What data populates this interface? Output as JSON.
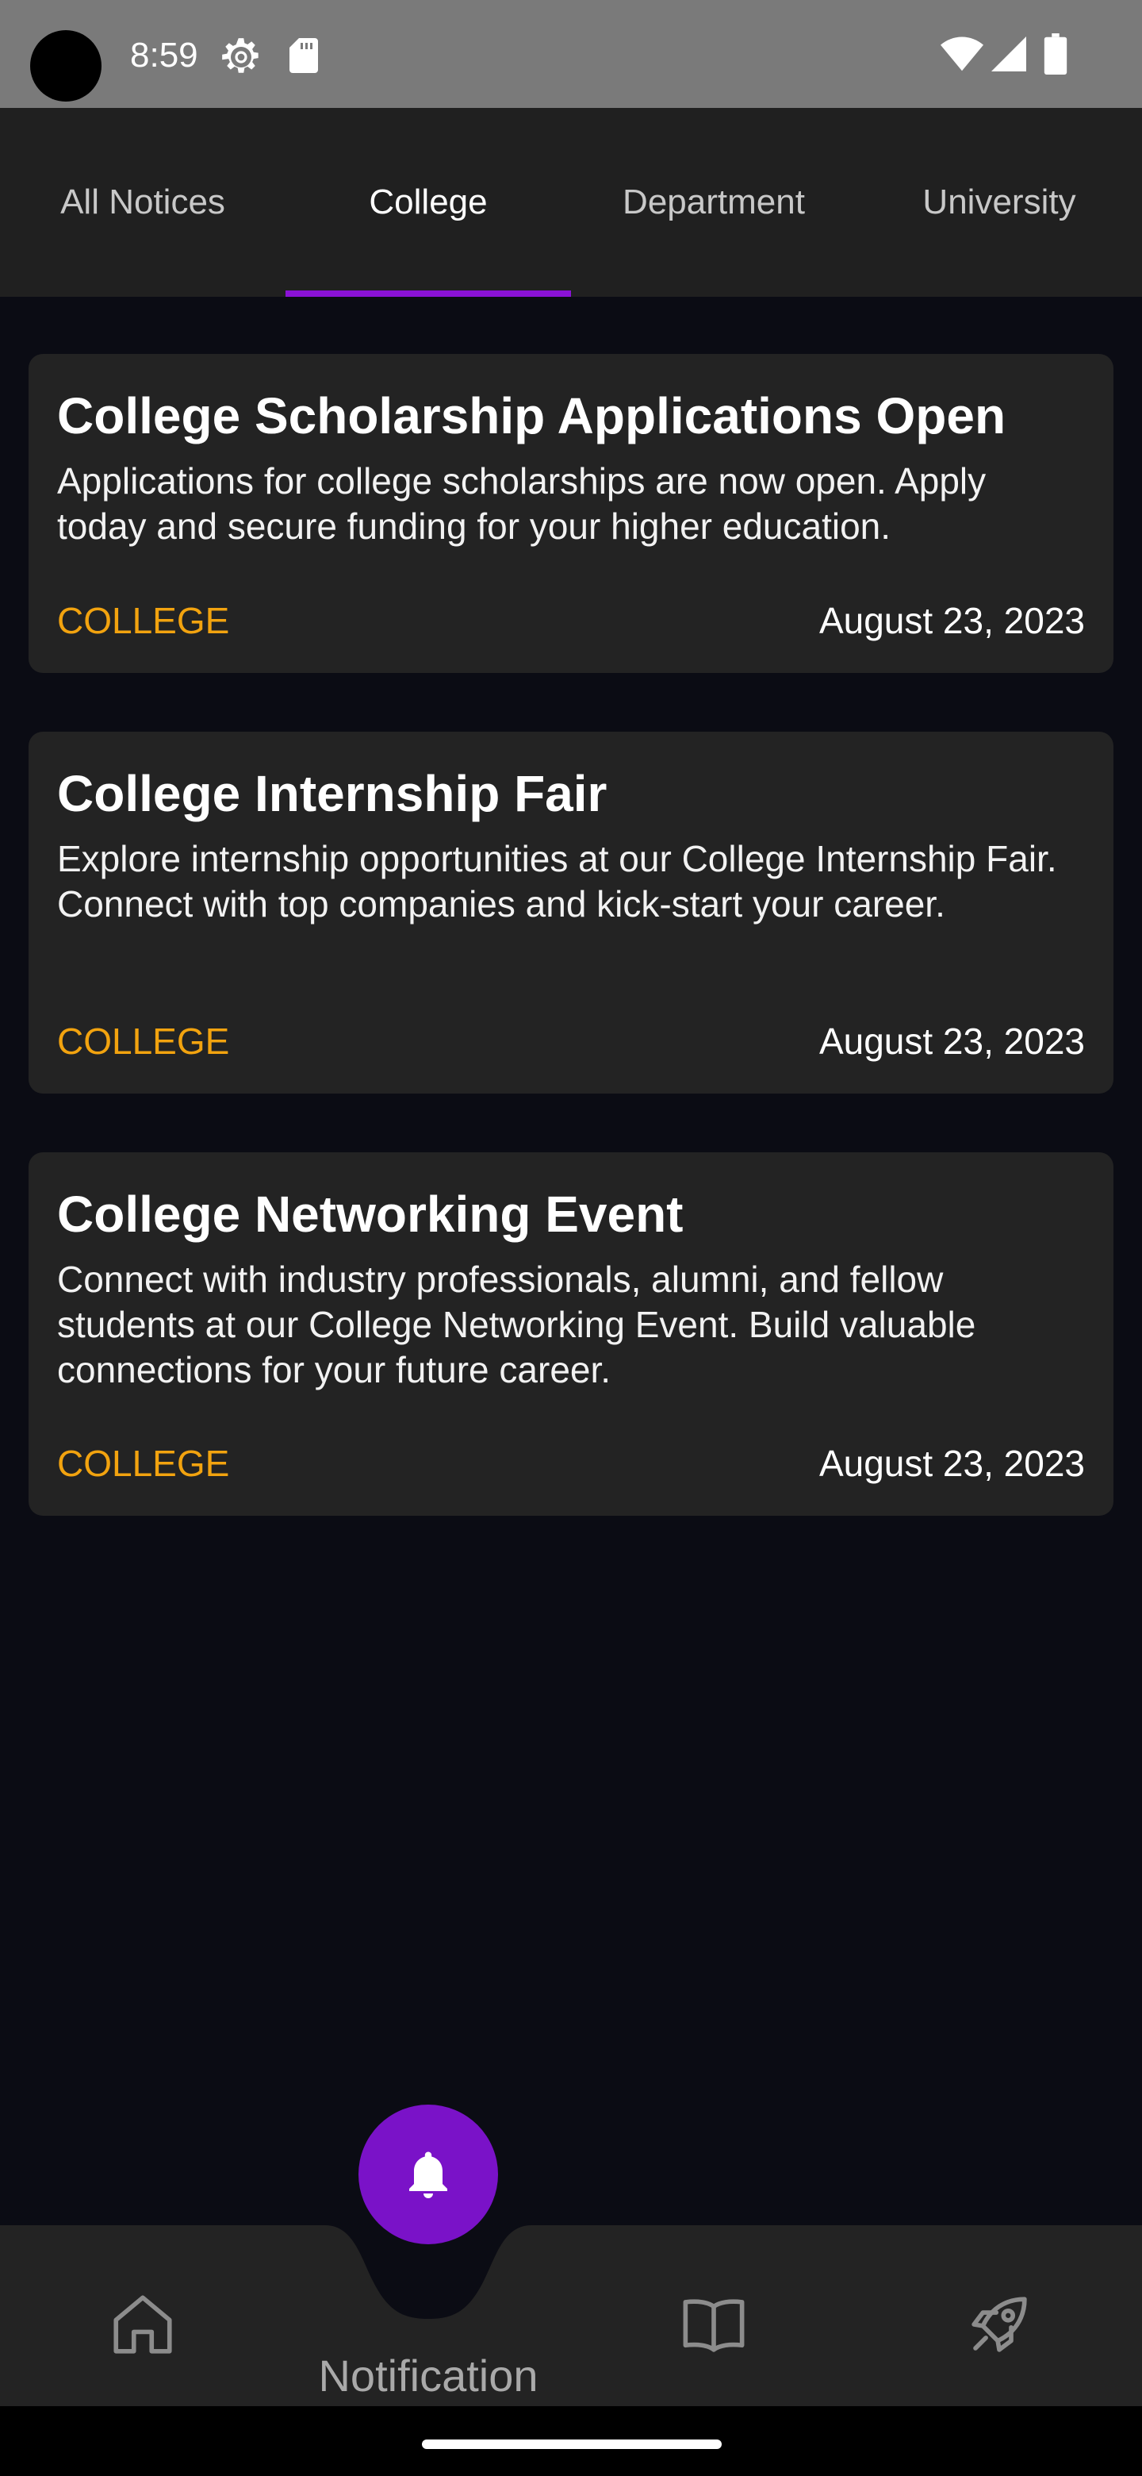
{
  "status_bar": {
    "time": "8:59",
    "icons": [
      "settings-gear-icon",
      "sd-card-icon",
      "wifi-icon",
      "cell-signal-icon",
      "battery-icon"
    ]
  },
  "tabs": [
    {
      "label": "All Notices",
      "active": false
    },
    {
      "label": "College",
      "active": true
    },
    {
      "label": "Department",
      "active": false
    },
    {
      "label": "University",
      "active": false
    }
  ],
  "notices": [
    {
      "title": "College Scholarship Applications Open",
      "body": "Applications for college scholarships are now open. Apply today and secure funding for your higher education.",
      "tag": "COLLEGE",
      "date": "August 23, 2023"
    },
    {
      "title": "College Internship Fair",
      "body": "Explore internship opportunities at our College Internship Fair. Connect with top companies and kick-start your career.",
      "tag": "COLLEGE",
      "date": "August 23, 2023"
    },
    {
      "title": "College Networking Event",
      "body": "Connect with industry professionals, alumni, and fellow students at our College Networking Event. Build valuable connections for your future career.",
      "tag": "COLLEGE",
      "date": "August 23, 2023"
    }
  ],
  "bottom_nav": {
    "items": [
      {
        "icon": "home-icon",
        "label": ""
      },
      {
        "icon": "bell-icon",
        "label": "Notification",
        "active": true
      },
      {
        "icon": "book-icon",
        "label": ""
      },
      {
        "icon": "rocket-icon",
        "label": ""
      }
    ]
  },
  "colors": {
    "background": "#0b0c14",
    "surface": "#232323",
    "accent": "#7a12c8",
    "tag": "#f2a30f"
  }
}
